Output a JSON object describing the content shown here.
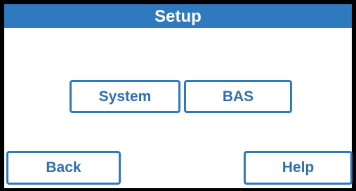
{
  "header": {
    "title": "Setup"
  },
  "main": {
    "system_label": "System",
    "bas_label": "BAS"
  },
  "footer": {
    "back_label": "Back",
    "help_label": "Help"
  },
  "colors": {
    "accent": "#2f7abf",
    "button_text": "#2f6fb0",
    "background": "#ffffff",
    "frame": "#000000"
  }
}
